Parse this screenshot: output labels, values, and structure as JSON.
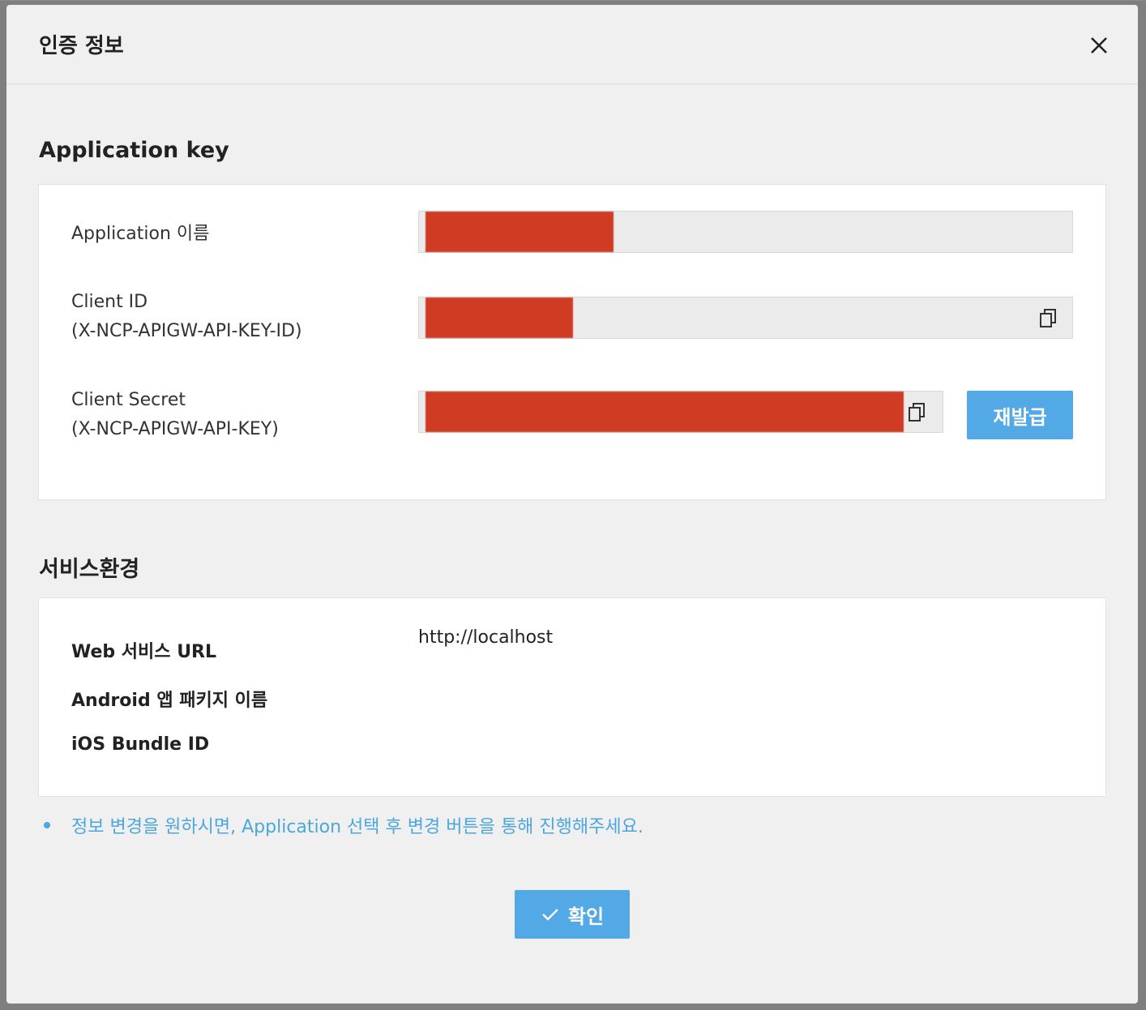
{
  "dialog": {
    "title": "인증 정보"
  },
  "application_key": {
    "section_title": "Application key",
    "app_name_label": "Application 이름",
    "client_id_label_line1": "Client ID",
    "client_id_label_line2": "(X-NCP-APIGW-API-KEY-ID)",
    "client_secret_label_line1": "Client Secret",
    "client_secret_label_line2": "(X-NCP-APIGW-API-KEY)",
    "reissue_label": "재발급"
  },
  "service_env": {
    "section_title": "서비스환경",
    "web_url_label": "Web 서비스 URL",
    "web_url_value": "http://localhost",
    "android_label": "Android 앱 패키지 이름",
    "ios_label": "iOS Bundle ID"
  },
  "notice": "정보 변경을 원하시면, Application 선택 후 변경 버튼을 통해 진행해주세요.",
  "confirm_label": "확인",
  "icons": {
    "close": "close-icon",
    "copy": "copy-icon",
    "check": "check-icon"
  },
  "colors": {
    "accent": "#52a9e6",
    "notice": "#4ca6df",
    "redaction": "#cf3b23"
  }
}
